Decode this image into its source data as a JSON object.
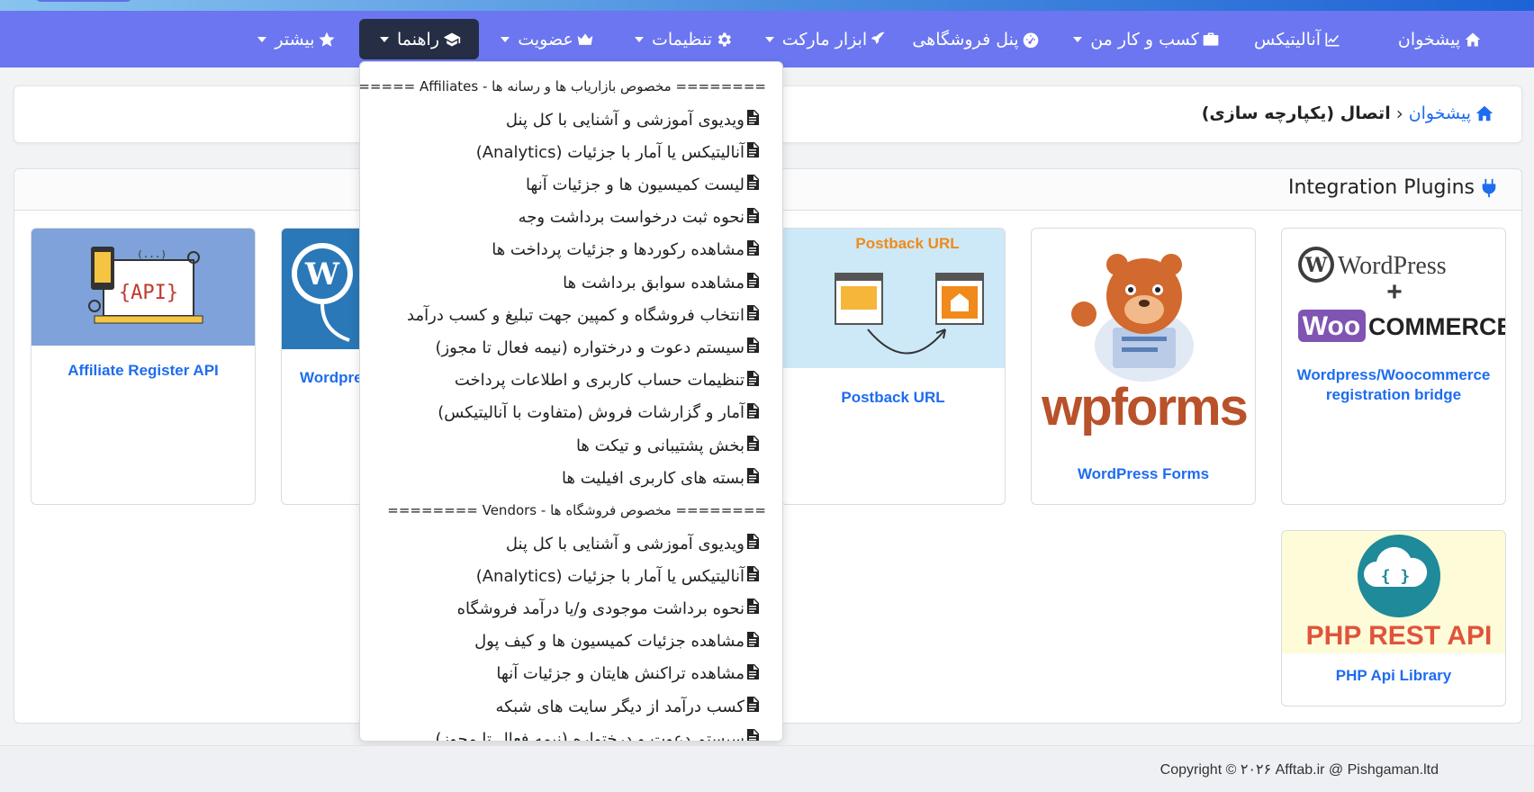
{
  "colors": {
    "navbar": "#6b76f0",
    "active_nav": "#252e44",
    "link": "#1e6cf0"
  },
  "nav": {
    "items": [
      {
        "label": "پیشخوان",
        "icon": "home-icon"
      },
      {
        "label": "آنالیتیکس",
        "icon": "chart-line-icon"
      },
      {
        "label": "کسب و کار من",
        "icon": "briefcase-icon"
      },
      {
        "label": "پنل فروشگاهی",
        "icon": "dashboard-gauge-icon"
      },
      {
        "label": "ابزار مارکت",
        "icon": "rocket-icon"
      },
      {
        "label": "تنظیمات",
        "icon": "gear-icon"
      },
      {
        "label": "عضویت",
        "icon": "crown-icon"
      },
      {
        "label": "راهنما",
        "icon": "graduation-cap-icon"
      },
      {
        "label": "بیشتر",
        "icon": "star-icon"
      }
    ]
  },
  "breadcrumb": {
    "home": "پیشخوان",
    "current": "اتصال (یکپارچه سازی)"
  },
  "card": {
    "title": "Integration Plugins"
  },
  "plugins": [
    {
      "name": "Wordpress/Woocommerce registration bridge",
      "image_text_1": "WordPress",
      "image_text_2": "WooCommerce"
    },
    {
      "name": "WordPress Forms",
      "image_text": "wpforms"
    },
    {
      "name": "Postback URL",
      "image_text": "Postback URL"
    },
    {
      "name": "Wordpress",
      "image_text": ""
    },
    {
      "name": "Affiliate Register API",
      "image_text": "{API}"
    },
    {
      "name": "PHP Api Library",
      "image_text": "PHP REST API"
    }
  ],
  "dropdown": {
    "section_affiliates": "======== مخصوص بازاریاب ها و رسانه ها - Affiliates ========",
    "affiliates": [
      "ویدیوی آموزشی و آشنایی با کل پنل",
      "آنالیتیکس یا آمار با جزئیات (Analytics)",
      "لیست کمیسیون ها و جزئیات آنها",
      "نحوه ثبت درخواست برداشت وجه",
      "مشاهده رکوردها و جزئیات پرداخت ها",
      "مشاهده سوابق برداشت ها",
      "انتخاب فروشگاه و کمپین جهت تبلیغ و کسب درآمد",
      "سیستم دعوت و درختواره (نیمه فعال تا مجوز)",
      "تنظیمات حساب کاربری و اطلاعات پرداخت",
      "آمار و گزارشات فروش (متفاوت با آنالیتیکس)",
      "بخش پشتیبانی و تیکت ها",
      "بسته های کاربری افیلیت ها"
    ],
    "section_vendors": "======== مخصوص فروشگاه ها - Vendors ========",
    "vendors": [
      "ویدیوی آموزشی و آشنایی با کل پنل",
      "آنالیتیکس یا آمار با جزئیات (Analytics)",
      "نحوه برداشت موجودی و/یا درآمد فروشگاه",
      "مشاهده جزئیات کمیسیون ها و کیف پول",
      "مشاهده تراکنش هایتان و جزئیات آنها",
      "کسب درآمد از دیگر سایت های شبکه",
      "سیستم دعوت و درختواره (نیمه فعال تا مجوز)"
    ]
  },
  "footer": {
    "copyright": "Copyright © ۲۰۲۶ Afftab.ir @ Pishgaman.ltd"
  }
}
